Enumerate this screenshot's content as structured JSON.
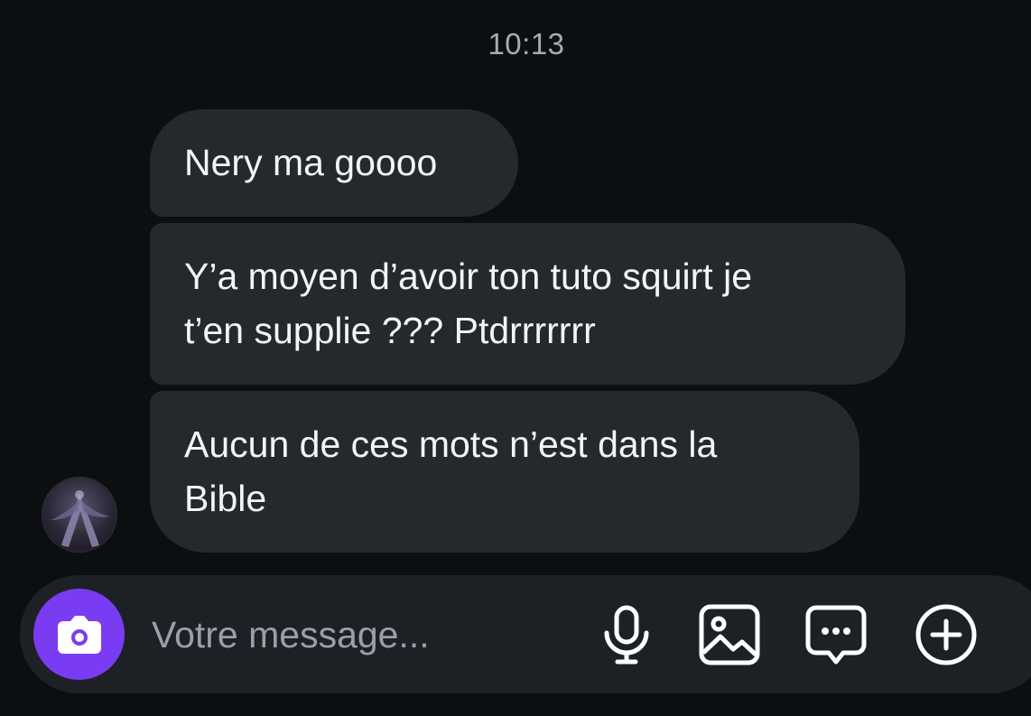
{
  "conversation": {
    "timestamp": "10:13",
    "messages": [
      {
        "lines": [
          "Nery ma goooo"
        ]
      },
      {
        "lines": [
          "Y’a moyen d’avoir ton tuto squirt je",
          "t’en supplie ??? Ptdrrrrrrr"
        ]
      },
      {
        "lines": [
          "Aucun de ces mots n’est dans la",
          "Bible"
        ]
      }
    ]
  },
  "composer": {
    "placeholder": "Votre message...",
    "accent_color": "#7a3cf2",
    "icons": [
      "camera-icon",
      "microphone-icon",
      "image-icon",
      "sticker-chat-icon",
      "plus-circle-icon"
    ]
  }
}
